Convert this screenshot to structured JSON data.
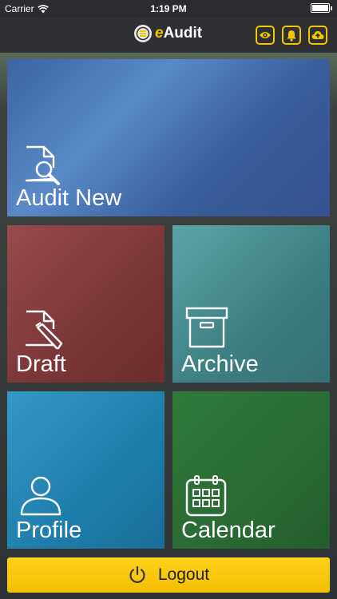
{
  "status_bar": {
    "carrier": "Carrier",
    "time": "1:19 PM"
  },
  "header": {
    "title_prefix": "e",
    "title_rest": "Audit"
  },
  "tiles": {
    "audit_new": {
      "label": "Audit New"
    },
    "draft": {
      "label": "Draft"
    },
    "archive": {
      "label": "Archive"
    },
    "profile": {
      "label": "Profile"
    },
    "calendar": {
      "label": "Calendar"
    }
  },
  "logout": {
    "label": "Logout"
  },
  "colors": {
    "accent": "#f5c400",
    "audit_tile": "#3f67a8",
    "draft_tile": "#7d3636",
    "archive_tile": "#3e8084",
    "profile_tile": "#2286b6",
    "calendar_tile": "#2b6b35"
  },
  "icons": {
    "audit": "document-search-icon",
    "draft": "document-pencil-icon",
    "archive": "archive-box-icon",
    "profile": "user-icon",
    "calendar": "calendar-icon",
    "logout": "power-icon",
    "nav": [
      "eye-icon",
      "bell-icon",
      "cloud-upload-icon"
    ]
  }
}
